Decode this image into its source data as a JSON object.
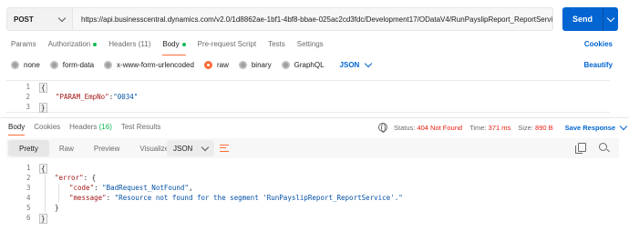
{
  "request": {
    "method": "POST",
    "url": "https://api.businesscentral.dynamics.com/v2.0/1d8862ae-1bf1-4bf8-bbae-025ac2cd3fdc/Development17/ODataV4/RunPayslipReport_ReportService ...",
    "send_label": "Send"
  },
  "request_tabs": [
    {
      "label": "Params"
    },
    {
      "label": "Authorization"
    },
    {
      "label": "Headers",
      "count": "(11)"
    },
    {
      "label": "Body"
    },
    {
      "label": "Pre-request Script"
    },
    {
      "label": "Tests"
    },
    {
      "label": "Settings"
    }
  ],
  "cookies_label": "Cookies",
  "body_types": [
    {
      "label": "none"
    },
    {
      "label": "form-data"
    },
    {
      "label": "x-www-form-urlencoded"
    },
    {
      "label": "raw"
    },
    {
      "label": "binary"
    },
    {
      "label": "GraphQL"
    }
  ],
  "body_format": "JSON",
  "beautify_label": "Beautify",
  "request_body": {
    "line_numbers": [
      "1",
      "2",
      "3"
    ],
    "open": "{",
    "key": "\"PARAM_EmpNo\"",
    "colon": ":",
    "value": "\"0034\"",
    "close": "}"
  },
  "response_tabs": [
    {
      "label": "Body"
    },
    {
      "label": "Cookies"
    },
    {
      "label": "Headers",
      "count": "(16)"
    },
    {
      "label": "Test Results"
    }
  ],
  "status": {
    "status_label": "Status:",
    "status_value": "404 Not Found",
    "time_label": "Time:",
    "time_value": "371 ms",
    "size_label": "Size:",
    "size_value": "890 B",
    "save_label": "Save Response"
  },
  "view_modes": [
    "Pretty",
    "Raw",
    "Preview",
    "Visualize"
  ],
  "response_format": "JSON",
  "response_body": {
    "line_numbers": [
      "1",
      "2",
      "3",
      "4",
      "5",
      "6"
    ],
    "l1": "{",
    "l2_key": "\"error\"",
    "l2_rest": ": {",
    "l3_key": "\"code\"",
    "l3_colon": ": ",
    "l3_val": "\"BadRequest_NotFound\"",
    "l3_comma": ",",
    "l4_key": "\"message\"",
    "l4_colon": ": ",
    "l4_val": "\"Resource not found for the segment 'RunPayslipReport_ReportService'.\"",
    "l5": "}",
    "l6": "}"
  },
  "colors": {
    "accent": "#ff6c37",
    "link": "#0265d2",
    "success": "#0cbb52",
    "error": "#eb2013"
  }
}
